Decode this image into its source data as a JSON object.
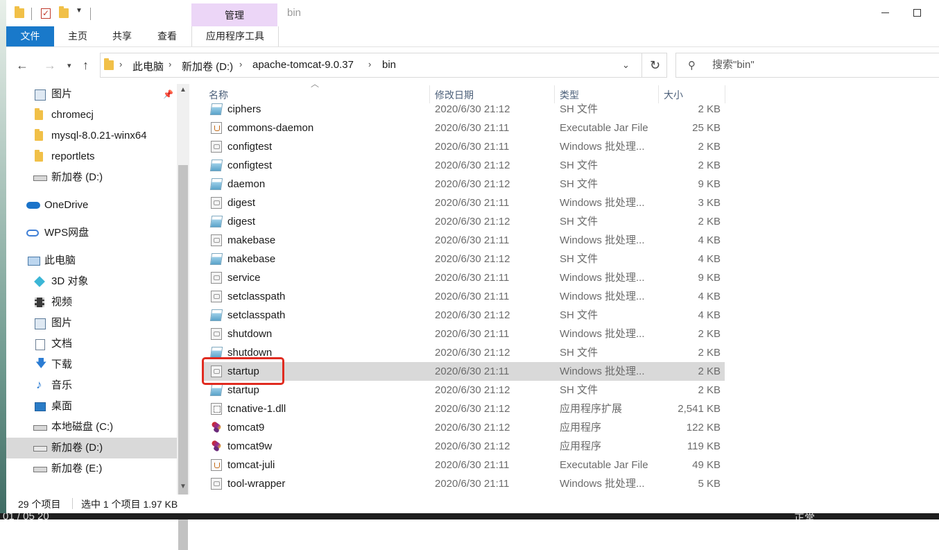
{
  "window": {
    "title": "bin",
    "manage_tab": "管理",
    "colors": {
      "file_tab": "#1979ca",
      "manage_tab": "#ecd6f7",
      "selected_row": "#d9d9d9",
      "highlight": "#e02b20"
    }
  },
  "ribbon": {
    "tabs": [
      "文件",
      "主页",
      "共享",
      "查看",
      "应用程序工具"
    ]
  },
  "address": {
    "crumbs": [
      "此电脑",
      "新加卷 (D:)",
      "apache-tomcat-9.0.37",
      "bin"
    ]
  },
  "search": {
    "placeholder": "搜索\"bin\""
  },
  "nav": {
    "items": [
      {
        "label": "图片",
        "icon": "pictures-icon"
      },
      {
        "label": "chromecj",
        "icon": "folder-icon"
      },
      {
        "label": "mysql-8.0.21-winx64",
        "icon": "folder-icon"
      },
      {
        "label": "reportlets",
        "icon": "folder-icon"
      },
      {
        "label": "新加卷 (D:)",
        "icon": "drive-icon"
      },
      {
        "label": "OneDrive",
        "icon": "onedrive-icon"
      },
      {
        "label": "WPS网盘",
        "icon": "wps-cloud-icon"
      },
      {
        "label": "此电脑",
        "icon": "this-pc-icon"
      },
      {
        "label": "3D 对象",
        "icon": "3d-objects-icon"
      },
      {
        "label": "视频",
        "icon": "videos-icon"
      },
      {
        "label": "图片",
        "icon": "pictures-icon"
      },
      {
        "label": "文档",
        "icon": "documents-icon"
      },
      {
        "label": "下载",
        "icon": "downloads-icon"
      },
      {
        "label": "音乐",
        "icon": "music-icon"
      },
      {
        "label": "桌面",
        "icon": "desktop-icon"
      },
      {
        "label": "本地磁盘 (C:)",
        "icon": "windows-drive-icon"
      },
      {
        "label": "新加卷 (D:)",
        "icon": "drive-icon"
      },
      {
        "label": "新加卷 (E:)",
        "icon": "drive-icon"
      }
    ]
  },
  "columns": {
    "name": "名称",
    "date": "修改日期",
    "type": "类型",
    "size": "大小"
  },
  "files": [
    {
      "name": "ciphers",
      "date": "2020/6/30 21:12",
      "type": "SH 文件",
      "size": "2 KB",
      "kind": "sh"
    },
    {
      "name": "commons-daemon",
      "date": "2020/6/30 21:11",
      "type": "Executable Jar File",
      "size": "25 KB",
      "kind": "jar"
    },
    {
      "name": "configtest",
      "date": "2020/6/30 21:11",
      "type": "Windows 批处理...",
      "size": "2 KB",
      "kind": "bat"
    },
    {
      "name": "configtest",
      "date": "2020/6/30 21:12",
      "type": "SH 文件",
      "size": "2 KB",
      "kind": "sh"
    },
    {
      "name": "daemon",
      "date": "2020/6/30 21:12",
      "type": "SH 文件",
      "size": "9 KB",
      "kind": "sh"
    },
    {
      "name": "digest",
      "date": "2020/6/30 21:11",
      "type": "Windows 批处理...",
      "size": "3 KB",
      "kind": "bat"
    },
    {
      "name": "digest",
      "date": "2020/6/30 21:12",
      "type": "SH 文件",
      "size": "2 KB",
      "kind": "sh"
    },
    {
      "name": "makebase",
      "date": "2020/6/30 21:11",
      "type": "Windows 批处理...",
      "size": "4 KB",
      "kind": "bat"
    },
    {
      "name": "makebase",
      "date": "2020/6/30 21:12",
      "type": "SH 文件",
      "size": "4 KB",
      "kind": "sh"
    },
    {
      "name": "service",
      "date": "2020/6/30 21:11",
      "type": "Windows 批处理...",
      "size": "9 KB",
      "kind": "bat"
    },
    {
      "name": "setclasspath",
      "date": "2020/6/30 21:11",
      "type": "Windows 批处理...",
      "size": "4 KB",
      "kind": "bat"
    },
    {
      "name": "setclasspath",
      "date": "2020/6/30 21:12",
      "type": "SH 文件",
      "size": "4 KB",
      "kind": "sh"
    },
    {
      "name": "shutdown",
      "date": "2020/6/30 21:11",
      "type": "Windows 批处理...",
      "size": "2 KB",
      "kind": "bat"
    },
    {
      "name": "shutdown",
      "date": "2020/6/30 21:12",
      "type": "SH 文件",
      "size": "2 KB",
      "kind": "sh"
    },
    {
      "name": "startup",
      "date": "2020/6/30 21:11",
      "type": "Windows 批处理...",
      "size": "2 KB",
      "kind": "bat",
      "selected": true
    },
    {
      "name": "startup",
      "date": "2020/6/30 21:12",
      "type": "SH 文件",
      "size": "2 KB",
      "kind": "sh"
    },
    {
      "name": "tcnative-1.dll",
      "date": "2020/6/30 21:12",
      "type": "应用程序扩展",
      "size": "2,541 KB",
      "kind": "dll"
    },
    {
      "name": "tomcat9",
      "date": "2020/6/30 21:12",
      "type": "应用程序",
      "size": "122 KB",
      "kind": "exe"
    },
    {
      "name": "tomcat9w",
      "date": "2020/6/30 21:12",
      "type": "应用程序",
      "size": "119 KB",
      "kind": "exe"
    },
    {
      "name": "tomcat-juli",
      "date": "2020/6/30 21:11",
      "type": "Executable Jar File",
      "size": "49 KB",
      "kind": "jar"
    },
    {
      "name": "tool-wrapper",
      "date": "2020/6/30 21:11",
      "type": "Windows 批处理...",
      "size": "5 KB",
      "kind": "bat"
    }
  ],
  "status": {
    "count": "29 个项目",
    "selected": "选中 1 个项目 1.97 KB"
  },
  "taskbar": {
    "time": "01 / 05 20",
    "tray": "正常"
  }
}
